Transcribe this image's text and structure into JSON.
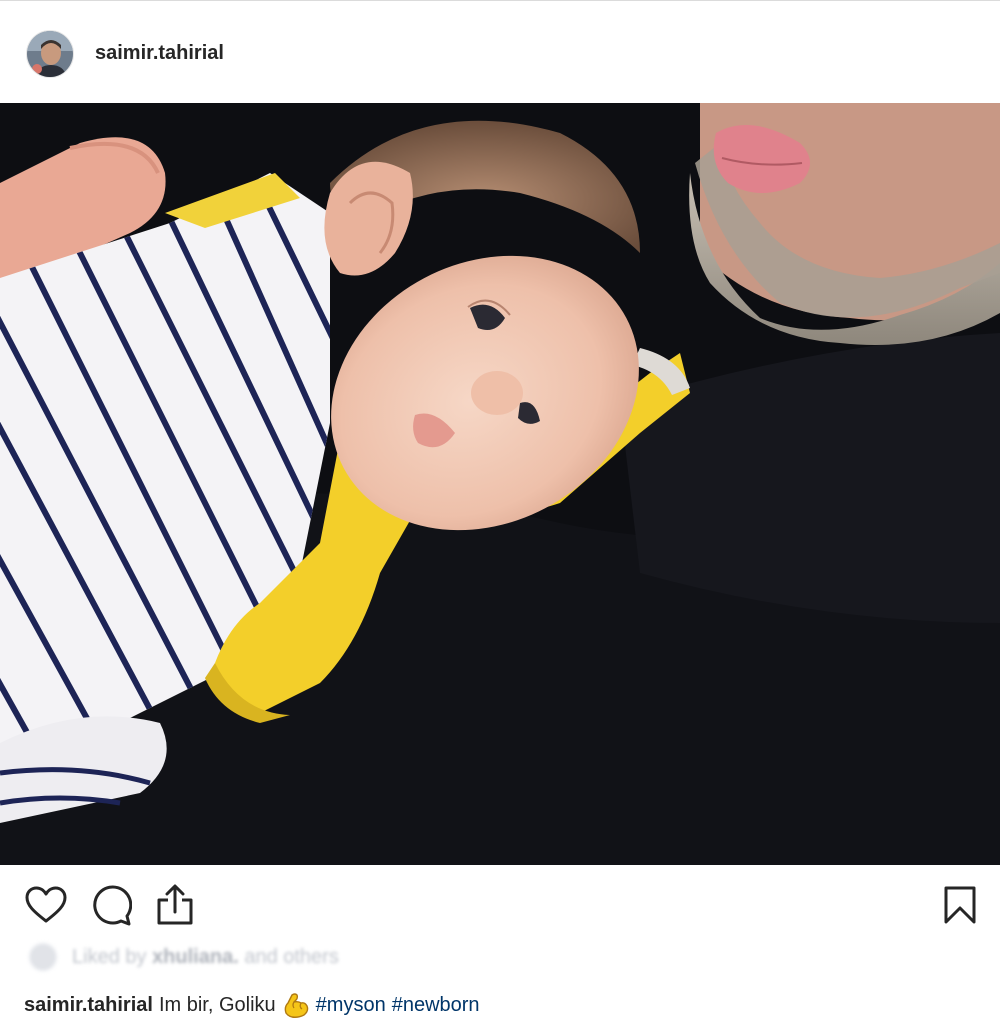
{
  "post": {
    "author": {
      "username": "saimir.tahirial",
      "avatar_icon": "user-avatar"
    },
    "photo": {
      "subject": "newborn-photo"
    },
    "actions": {
      "like_icon": "heart-icon",
      "comment_icon": "comment-icon",
      "share_icon": "share-icon",
      "save_icon": "bookmark-icon"
    },
    "likes": {
      "prefix": "Liked by",
      "user": "xhuliana.",
      "rest": "and others"
    },
    "caption": {
      "username": "saimir.tahirial",
      "text": "Im bir, Goliku",
      "emoji_icon": "flexed-biceps-icon",
      "hashtags": [
        "#myson",
        "#newborn"
      ]
    }
  },
  "colors": {
    "text": "#262626",
    "hashtag": "#003569",
    "border": "#dbdbdb"
  }
}
